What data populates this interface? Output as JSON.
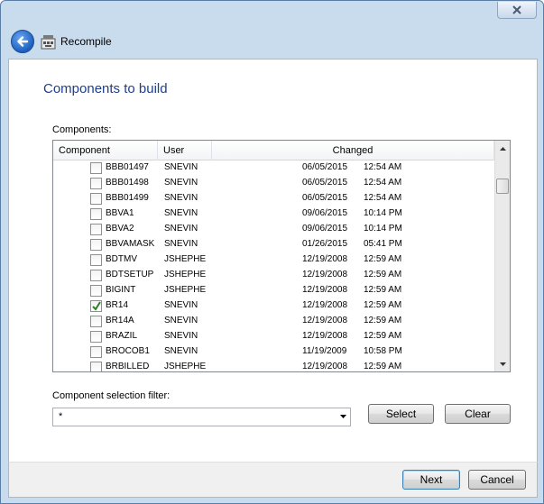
{
  "window": {
    "title": "Recompile"
  },
  "page": {
    "title": "Components to build",
    "components_label": "Components:",
    "filter_label": "Component selection filter:",
    "filter_value": "*"
  },
  "table": {
    "columns": [
      "Component",
      "User",
      "Changed"
    ],
    "rows": [
      {
        "name": "BBB01497",
        "user": "SNEVIN",
        "date": "06/05/2015",
        "time": "12:54 AM",
        "checked": false
      },
      {
        "name": "BBB01498",
        "user": "SNEVIN",
        "date": "06/05/2015",
        "time": "12:54 AM",
        "checked": false
      },
      {
        "name": "BBB01499",
        "user": "SNEVIN",
        "date": "06/05/2015",
        "time": "12:54 AM",
        "checked": false
      },
      {
        "name": "BBVA1",
        "user": "SNEVIN",
        "date": "09/06/2015",
        "time": "10:14 PM",
        "checked": false
      },
      {
        "name": "BBVA2",
        "user": "SNEVIN",
        "date": "09/06/2015",
        "time": "10:14 PM",
        "checked": false
      },
      {
        "name": "BBVAMASK",
        "user": "SNEVIN",
        "date": "01/26/2015",
        "time": "05:41 PM",
        "checked": false
      },
      {
        "name": "BDTMV",
        "user": "JSHEPHE",
        "date": "12/19/2008",
        "time": "12:59 AM",
        "checked": false
      },
      {
        "name": "BDTSETUP",
        "user": "JSHEPHE",
        "date": "12/19/2008",
        "time": "12:59 AM",
        "checked": false
      },
      {
        "name": "BIGINT",
        "user": "JSHEPHE",
        "date": "12/19/2008",
        "time": "12:59 AM",
        "checked": false
      },
      {
        "name": "BR14",
        "user": "SNEVIN",
        "date": "12/19/2008",
        "time": "12:59 AM",
        "checked": true
      },
      {
        "name": "BR14A",
        "user": "SNEVIN",
        "date": "12/19/2008",
        "time": "12:59 AM",
        "checked": false
      },
      {
        "name": "BRAZIL",
        "user": "SNEVIN",
        "date": "12/19/2008",
        "time": "12:59 AM",
        "checked": false
      },
      {
        "name": "BROCOB1",
        "user": "SNEVIN",
        "date": "11/19/2009",
        "time": "10:58 PM",
        "checked": false
      },
      {
        "name": "BRBILLED",
        "user": "JSHEPHE",
        "date": "12/19/2008",
        "time": "12:59 AM",
        "checked": false
      }
    ]
  },
  "buttons": {
    "select": "Select",
    "clear": "Clear",
    "next": "Next",
    "cancel": "Cancel"
  },
  "icons": {
    "back": "back-arrow-icon",
    "app": "recompile-app-icon",
    "close": "close-icon"
  }
}
